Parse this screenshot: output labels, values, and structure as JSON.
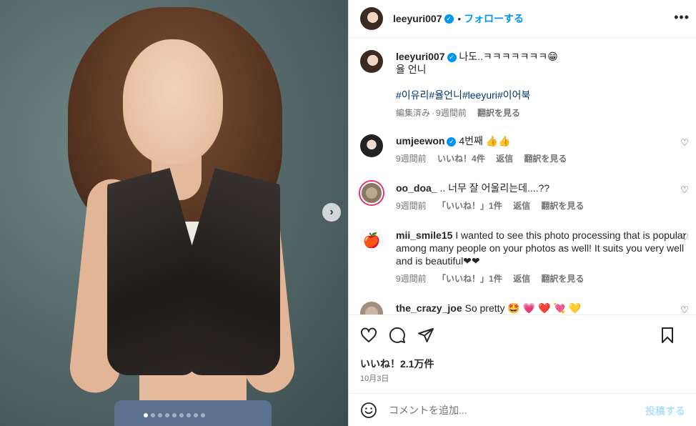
{
  "post": {
    "username": "leeyuri007",
    "follow_label": "フォローする",
    "dot": "•",
    "more_icon": "more-horizontal-icon"
  },
  "carousel": {
    "slide_count": 9,
    "active_index": 0
  },
  "caption": {
    "username": "leeyuri007",
    "line1": "나도..ㅋㅋㅋㅋㅋㅋㅋ😁",
    "line2": "율 언니",
    "hashtags": "#이유리#율언니#leeyuri#이어북",
    "edited": "編集済み",
    "dot": "·",
    "time": "9週間前",
    "translate": "翻訳を見る"
  },
  "comments": [
    {
      "username": "umjeewon",
      "verified": true,
      "text": "4번째 👍👍",
      "time": "9週間前",
      "likes": "いいね！4件",
      "reply": "返信",
      "translate": "翻訳を見る"
    },
    {
      "username": "oo_doa_",
      "verified": false,
      "text": ".. 너무 잘 어울리는데....??",
      "time": "9週間前",
      "likes": "「いいね！」1件",
      "reply": "返信",
      "translate": "翻訳を見る"
    },
    {
      "username": "mii_smile15",
      "verified": false,
      "text": "I wanted to see this photo processing that is popular among many people on your photos as well! It suits you very well and is beautiful❤❤",
      "time": "9週間前",
      "likes": "「いいね！」1件",
      "reply": "返信",
      "translate": "翻訳を見る"
    },
    {
      "username": "the_crazy_joe",
      "verified": false,
      "text": "So pretty 🤩 💗 ❤️ 💘 💛"
    }
  ],
  "actions": {
    "likes_label": "いいね！2.1万件",
    "date": "10月3日"
  },
  "add_comment": {
    "placeholder": "コメントを追加...",
    "post_label": "投稿する"
  },
  "colors": {
    "accent": "#0095f6",
    "hashtag": "#00376b",
    "muted": "#737373"
  }
}
